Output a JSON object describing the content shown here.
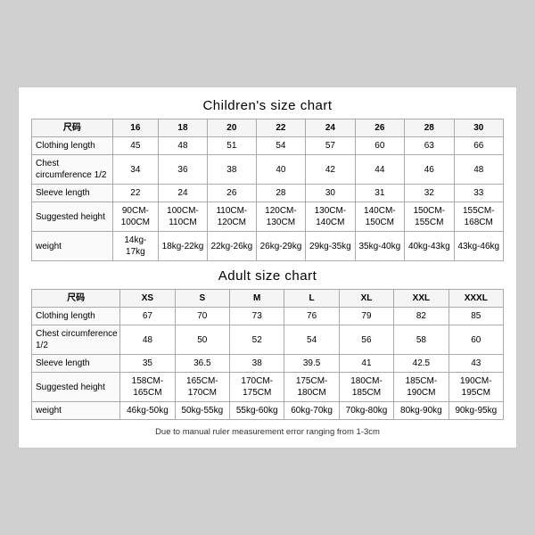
{
  "children_chart": {
    "title": "Children's size chart",
    "columns": [
      "尺码",
      "16",
      "18",
      "20",
      "22",
      "24",
      "26",
      "28",
      "30"
    ],
    "rows": [
      {
        "label": "Clothing length",
        "values": [
          "45",
          "48",
          "51",
          "54",
          "57",
          "60",
          "63",
          "66"
        ]
      },
      {
        "label": "Chest circumference 1/2",
        "values": [
          "34",
          "36",
          "38",
          "40",
          "42",
          "44",
          "46",
          "48"
        ]
      },
      {
        "label": "Sleeve length",
        "values": [
          "22",
          "24",
          "26",
          "28",
          "30",
          "31",
          "32",
          "33"
        ]
      },
      {
        "label": "Suggested height",
        "values": [
          "90CM-100CM",
          "100CM-110CM",
          "110CM-120CM",
          "120CM-130CM",
          "130CM-140CM",
          "140CM-150CM",
          "150CM-155CM",
          "155CM-168CM"
        ]
      },
      {
        "label": "weight",
        "values": [
          "14kg-17kg",
          "18kg-22kg",
          "22kg-26kg",
          "26kg-29kg",
          "29kg-35kg",
          "35kg-40kg",
          "40kg-43kg",
          "43kg-46kg"
        ]
      }
    ]
  },
  "adult_chart": {
    "title": "Adult size chart",
    "columns": [
      "尺码",
      "XS",
      "S",
      "M",
      "L",
      "XL",
      "XXL",
      "XXXL"
    ],
    "rows": [
      {
        "label": "Clothing length",
        "values": [
          "67",
          "70",
          "73",
          "76",
          "79",
          "82",
          "85"
        ]
      },
      {
        "label": "Chest circumference 1/2",
        "values": [
          "48",
          "50",
          "52",
          "54",
          "56",
          "58",
          "60"
        ]
      },
      {
        "label": "Sleeve length",
        "values": [
          "35",
          "36.5",
          "38",
          "39.5",
          "41",
          "42.5",
          "43"
        ]
      },
      {
        "label": "Suggested height",
        "values": [
          "158CM-165CM",
          "165CM-170CM",
          "170CM-175CM",
          "175CM-180CM",
          "180CM-185CM",
          "185CM-190CM",
          "190CM-195CM"
        ]
      },
      {
        "label": "weight",
        "values": [
          "46kg-50kg",
          "50kg-55kg",
          "55kg-60kg",
          "60kg-70kg",
          "70kg-80kg",
          "80kg-90kg",
          "90kg-95kg"
        ]
      }
    ]
  },
  "footer": "Due to manual ruler measurement error ranging from 1-3cm"
}
